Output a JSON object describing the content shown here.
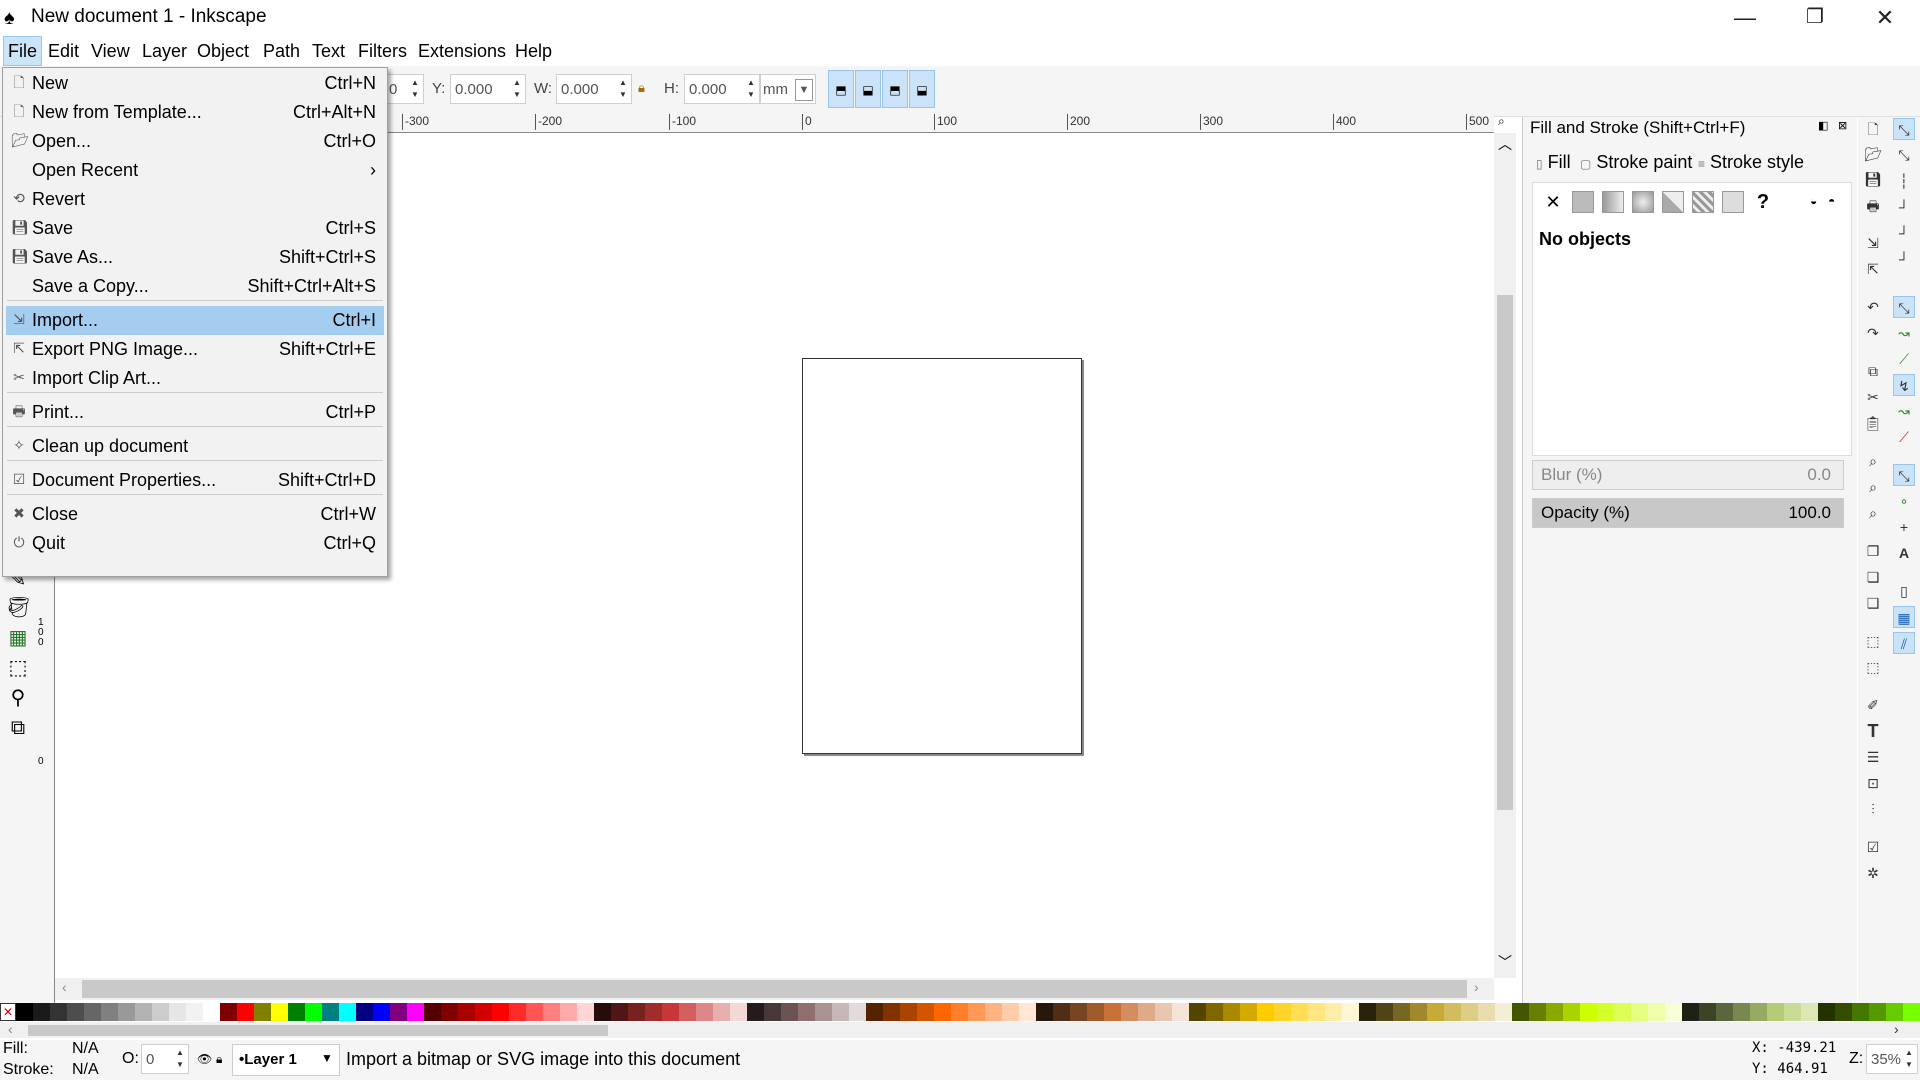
{
  "window": {
    "title": "New document 1 - Inkscape",
    "minimize": "—",
    "restore": "❐",
    "close": "✕"
  },
  "menubar": [
    "File",
    "Edit",
    "View",
    "Layer",
    "Object",
    "Path",
    "Text",
    "Filters",
    "Extensions",
    "Help"
  ],
  "toolbar": {
    "x_value": "0",
    "y_label": "Y:",
    "y_value": "0.000",
    "w_label": "W:",
    "w_value": "0.000",
    "h_label": "H:",
    "h_value": "0.000",
    "unit": "mm"
  },
  "ruler": {
    "ticks": [
      "-300",
      "-200",
      "-100",
      "0",
      "100",
      "200",
      "300",
      "400",
      "500"
    ]
  },
  "vruler": {
    "labels": [
      "100",
      "0"
    ]
  },
  "file_menu": [
    {
      "label": "New",
      "shortcut": "Ctrl+N",
      "icon": "new-doc-icon"
    },
    {
      "label": "New from Template...",
      "shortcut": "Ctrl+Alt+N",
      "icon": "template-icon"
    },
    {
      "label": "Open...",
      "shortcut": "Ctrl+O",
      "icon": "open-folder-icon"
    },
    {
      "label": "Open Recent",
      "shortcut": "›",
      "icon": ""
    },
    {
      "label": "Revert",
      "shortcut": "",
      "icon": "revert-icon"
    },
    {
      "label": "Save",
      "shortcut": "Ctrl+S",
      "icon": "save-icon"
    },
    {
      "label": "Save As...",
      "shortcut": "Shift+Ctrl+S",
      "icon": "save-as-icon"
    },
    {
      "label": "Save a Copy...",
      "shortcut": "Shift+Ctrl+Alt+S",
      "icon": ""
    },
    {
      "label": "Import...",
      "shortcut": "Ctrl+I",
      "icon": "import-icon"
    },
    {
      "label": "Export PNG Image...",
      "shortcut": "Shift+Ctrl+E",
      "icon": "export-icon"
    },
    {
      "label": "Import Clip Art...",
      "shortcut": "",
      "icon": "clipart-icon"
    },
    {
      "label": "Print...",
      "shortcut": "Ctrl+P",
      "icon": "print-icon"
    },
    {
      "label": "Clean up document",
      "shortcut": "",
      "icon": "cleanup-icon"
    },
    {
      "label": "Document Properties...",
      "shortcut": "Shift+Ctrl+D",
      "icon": "doc-properties-icon"
    },
    {
      "label": "Close",
      "shortcut": "Ctrl+W",
      "icon": "close-doc-icon"
    },
    {
      "label": "Quit",
      "shortcut": "Ctrl+Q",
      "icon": "quit-icon"
    }
  ],
  "dock": {
    "title": "Fill and Stroke (Shift+Ctrl+F)",
    "tabs": [
      "Fill",
      "Stroke paint",
      "Stroke style"
    ],
    "no_objects": "No objects",
    "blur_label": "Blur (%)",
    "blur_value": "0.0",
    "opacity_label": "Opacity (%)",
    "opacity_value": "100.0",
    "unknown_paint": "?",
    "no_paint": "✕"
  },
  "status": {
    "fill_label": "Fill:",
    "fill_value": "N/A",
    "stroke_label": "Stroke:",
    "stroke_value": "N/A",
    "o_label": "O:",
    "o_value": "0",
    "layer": "•Layer 1",
    "message": "Import a bitmap or SVG image into this document",
    "x_coord": "X: -439.21",
    "y_coord": "Y: 464.91",
    "z_label": "Z:",
    "zoom": "35%"
  },
  "palette": [
    "#000000",
    "#1a1a1a",
    "#333333",
    "#4d4d4d",
    "#666666",
    "#808080",
    "#999999",
    "#b3b3b3",
    "#cccccc",
    "#e6e6e6",
    "#f2f2f2",
    "#ffffff",
    "#800000",
    "#ff0000",
    "#808000",
    "#ffff00",
    "#008000",
    "#00ff00",
    "#008080",
    "#00ffff",
    "#000080",
    "#0000ff",
    "#800080",
    "#ff00ff",
    "#550000",
    "#800000",
    "#aa0000",
    "#d40000",
    "#ff0000",
    "#ff2a2a",
    "#ff5555",
    "#ff8080",
    "#ffaaaa",
    "#ffd5d5",
    "#280b0b",
    "#501616",
    "#782121",
    "#a02c2c",
    "#c83737",
    "#d35f5f",
    "#de8787",
    "#e9afaf",
    "#f4d7d7",
    "#241c1c",
    "#483737",
    "#6c5353",
    "#916f6f",
    "#ac9393",
    "#c8b7b7",
    "#e3dbdb",
    "#552200",
    "#803300",
    "#aa4400",
    "#d45500",
    "#ff6600",
    "#ff7f2a",
    "#ff9955",
    "#ffb380",
    "#ffccaa",
    "#ffe6d5",
    "#28170b",
    "#502d16",
    "#784421",
    "#a05a2c",
    "#c87137",
    "#d38d5f",
    "#deaa87",
    "#e9c6af",
    "#f4e3d7",
    "#554400",
    "#806600",
    "#aa8800",
    "#d4aa00",
    "#ffcc00",
    "#ffd42a",
    "#ffdd55",
    "#ffe680",
    "#ffeeaa",
    "#fff6d5",
    "#28220b",
    "#504416",
    "#786721",
    "#a0892c",
    "#c8ab37",
    "#d3bc5f",
    "#decd87",
    "#e9ddaf",
    "#f4eed7",
    "#445500",
    "#668000",
    "#88aa00",
    "#aad400",
    "#ccff00",
    "#d4ff2a",
    "#ddff55",
    "#e5ff80",
    "#eeffaa",
    "#f6ffd5",
    "#1e2216",
    "#3c4428",
    "#5a663c",
    "#788850",
    "#96aa64",
    "#b4cc78",
    "#c8dc96",
    "#dce8b4",
    "#223300",
    "#334d00",
    "#447700",
    "#559900",
    "#66cc00",
    "#77ff00"
  ]
}
